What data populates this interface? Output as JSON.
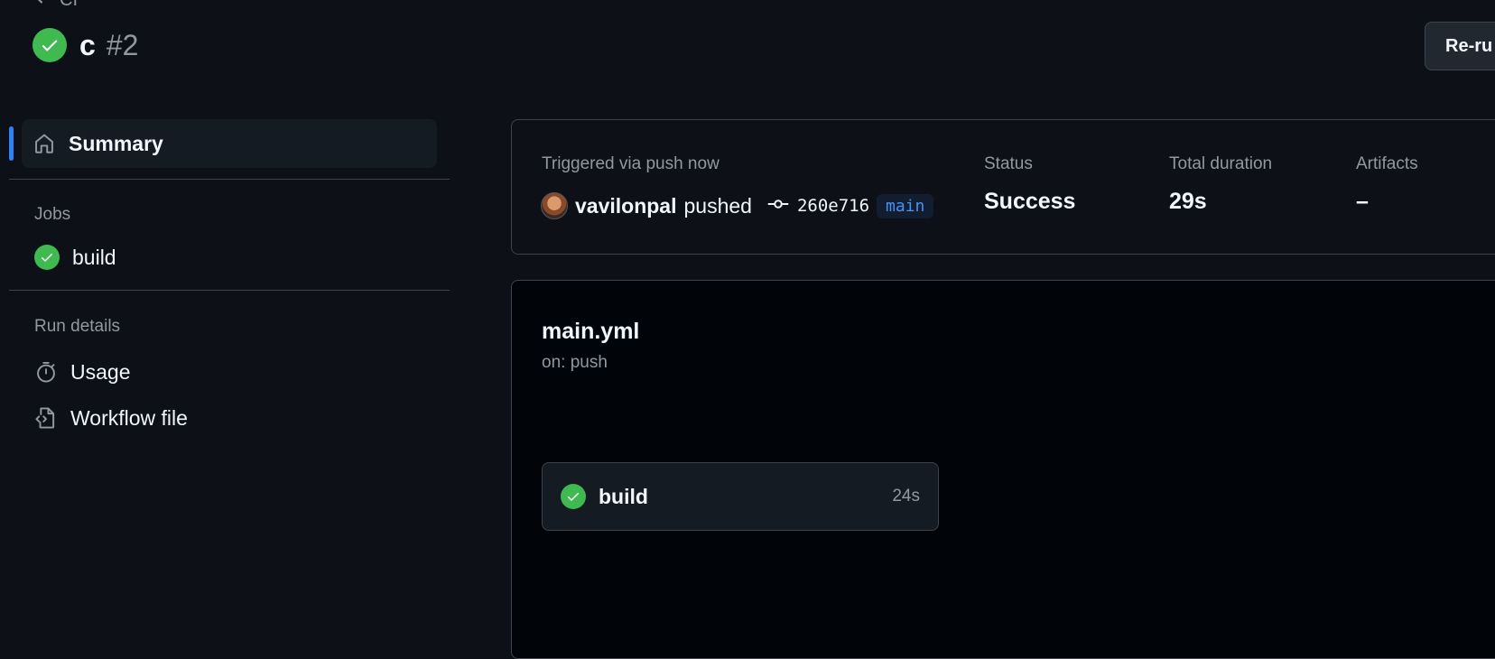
{
  "header": {
    "back_label": "CI",
    "title_name": "c",
    "title_number": "#2",
    "rerun_label": "Re-ru"
  },
  "sidebar": {
    "summary_label": "Summary",
    "jobs_title": "Jobs",
    "jobs": [
      {
        "label": "build"
      }
    ],
    "run_details_title": "Run details",
    "details": [
      {
        "label": "Usage",
        "icon": "stopwatch-icon"
      },
      {
        "label": "Workflow file",
        "icon": "file-code-icon"
      }
    ]
  },
  "summary": {
    "trigger_label": "Triggered via push now",
    "user": "vavilonpal",
    "action": "pushed",
    "commit": "260e716",
    "branch": "main",
    "status_label": "Status",
    "status_value": "Success",
    "duration_label": "Total duration",
    "duration_value": "29s",
    "artifacts_label": "Artifacts",
    "artifacts_value": "–"
  },
  "graph": {
    "workflow_name": "main.yml",
    "workflow_trigger": "on: push",
    "job_name": "build",
    "job_duration": "24s"
  },
  "colors": {
    "background": "#0d1117",
    "success": "#3fb950",
    "accent": "#2f81f7",
    "branch": "#4493f8",
    "muted": "#9198a1"
  }
}
